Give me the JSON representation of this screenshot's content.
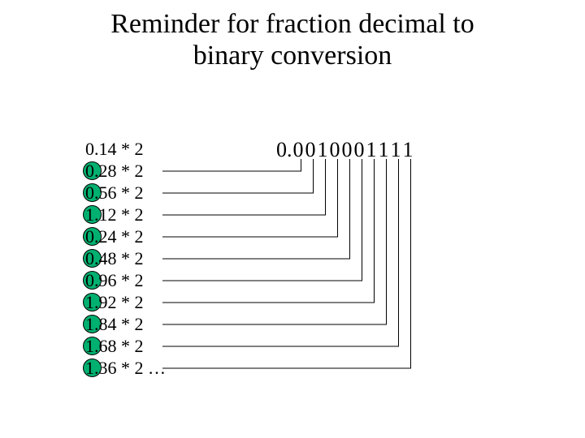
{
  "title_line1": "Reminder for fraction decimal to",
  "title_line2": "binary conversion",
  "steps": [
    {
      "int": "0",
      "frac": "14",
      "mul": " * 2",
      "circled": false
    },
    {
      "int": "0",
      "frac": "28",
      "mul": " * 2",
      "circled": true
    },
    {
      "int": "0",
      "frac": "56",
      "mul": " * 2",
      "circled": true
    },
    {
      "int": "1",
      "frac": "12",
      "mul": " * 2",
      "circled": true
    },
    {
      "int": "0",
      "frac": "24",
      "mul": " * 2",
      "circled": true
    },
    {
      "int": "0",
      "frac": "48",
      "mul": " * 2",
      "circled": true
    },
    {
      "int": "0",
      "frac": "96",
      "mul": " * 2",
      "circled": true
    },
    {
      "int": "1",
      "frac": "92",
      "mul": " * 2",
      "circled": true
    },
    {
      "int": "1",
      "frac": "84",
      "mul": " * 2",
      "circled": true
    },
    {
      "int": "1",
      "frac": "68",
      "mul": " * 2",
      "circled": true
    },
    {
      "int": "1",
      "frac": "36",
      "mul": " * 2 …",
      "circled": true
    }
  ],
  "binary": {
    "prefix": "0.",
    "digits": [
      "0",
      "0",
      "1",
      "0",
      "0",
      "0",
      "1",
      "1",
      "1",
      "1"
    ]
  },
  "connectors": [
    {
      "r": 1,
      "d": 0
    },
    {
      "r": 2,
      "d": 1
    },
    {
      "r": 3,
      "d": 2
    },
    {
      "r": 4,
      "d": 3
    },
    {
      "r": 5,
      "d": 4
    },
    {
      "r": 6,
      "d": 5
    },
    {
      "r": 7,
      "d": 6
    },
    {
      "r": 8,
      "d": 7
    },
    {
      "r": 9,
      "d": 8
    },
    {
      "r": 10,
      "d": 9
    }
  ]
}
